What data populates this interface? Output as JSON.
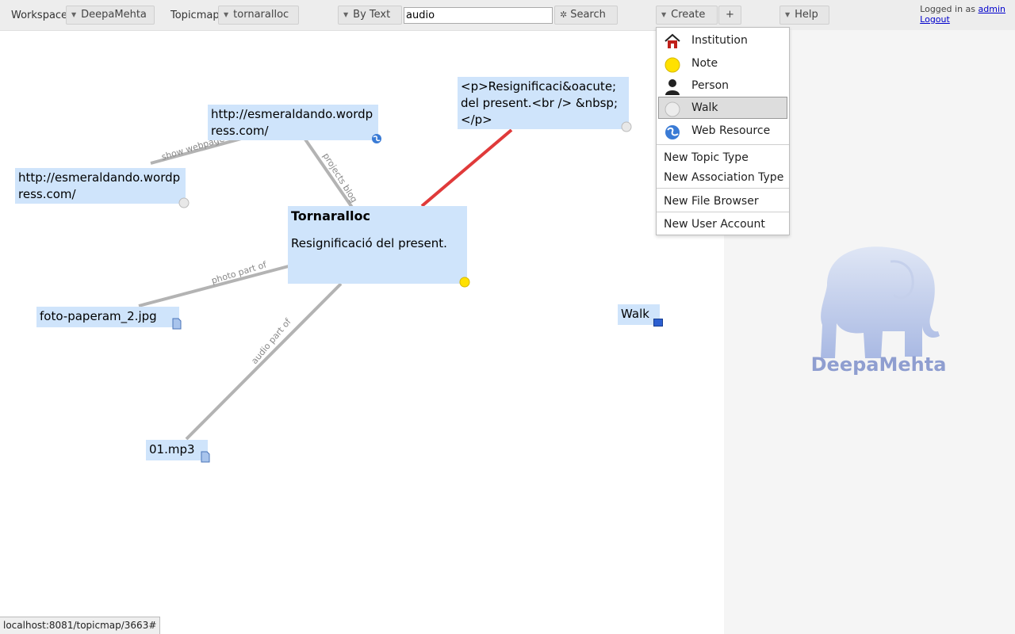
{
  "toolbar": {
    "workspace_label": "Workspace",
    "workspace_value": "DeepaMehta",
    "topicmap_label": "Topicmap",
    "topicmap_value": "tornaralloc",
    "search_mode": "By Text",
    "search_value": "audio",
    "search_button": "Search",
    "create_button": "Create",
    "plus_button": "+",
    "help_button": "Help",
    "login_prefix": "Logged in as",
    "login_user": "admin",
    "logout": "Logout"
  },
  "create_menu": {
    "type_items": [
      {
        "label": "Institution",
        "icon": "house-icon"
      },
      {
        "label": "Note",
        "icon": "yellow-dot-icon"
      },
      {
        "label": "Person",
        "icon": "person-icon"
      },
      {
        "label": "Walk",
        "icon": "gray-dot-icon",
        "selected": true
      },
      {
        "label": "Web Resource",
        "icon": "globe-icon"
      }
    ],
    "actions": [
      "New Topic Type",
      "New Association Type",
      "New File Browser",
      "New User Account"
    ]
  },
  "topicmap": {
    "topics": {
      "web_top": "http://esmeraldando.wordpress.com/",
      "web_left": "http://esmeraldando.wordpress.com/",
      "note_html": "<p>Resignificaci&oacute; del present.<br /> &nbsp;</p>",
      "main_title": "Tornaralloc",
      "main_subtitle": "Resignificació del present.",
      "photo": "foto-paperam_2.jpg",
      "audio": "01.mp3",
      "walk": "Walk"
    },
    "associations": {
      "show_webpage": "show webpage",
      "projects_blog": "projects blog",
      "photo_part_of": "photo part of",
      "audio_part_of": "audio part of"
    },
    "colors": {
      "topic_bg": "#cfe4fb",
      "assoc": "#b3b3b3",
      "highlight_assoc": "#e03a3a"
    }
  },
  "detail_panel": {
    "logo_text": "DeepaMehta"
  },
  "status_bar": {
    "url": "localhost:8081/topicmap/3663#"
  }
}
